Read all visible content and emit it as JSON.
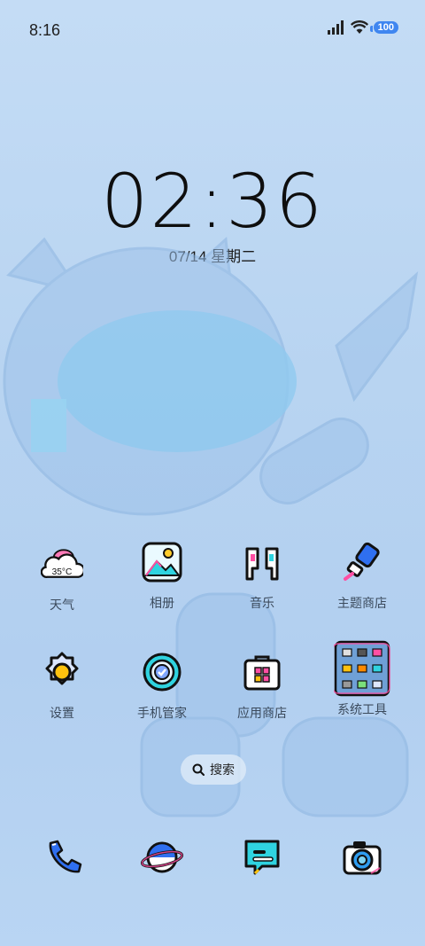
{
  "status": {
    "time": "8:16",
    "battery": "100",
    "signal_icon": "signal-icon",
    "wifi_icon": "wifi-icon"
  },
  "lock": {
    "clock": "02:36",
    "date": "07/14 星期二"
  },
  "apps_row1": [
    {
      "label": "天气",
      "icon": "weather-icon",
      "icon_text": "35°C"
    },
    {
      "label": "相册",
      "icon": "gallery-icon"
    },
    {
      "label": "音乐",
      "icon": "music-icon"
    },
    {
      "label": "主题商店",
      "icon": "theme-store-icon"
    }
  ],
  "apps_row2": [
    {
      "label": "设置",
      "icon": "settings-icon"
    },
    {
      "label": "手机管家",
      "icon": "phone-manager-icon"
    },
    {
      "label": "应用商店",
      "icon": "app-store-icon"
    },
    {
      "label": "系统工具",
      "icon": "system-tools-folder-icon"
    }
  ],
  "search": {
    "label": "搜索",
    "icon": "search-icon"
  },
  "dock": [
    {
      "name": "phone",
      "icon": "phone-icon"
    },
    {
      "name": "browser",
      "icon": "browser-icon"
    },
    {
      "name": "messages",
      "icon": "messages-icon"
    },
    {
      "name": "camera",
      "icon": "camera-icon"
    }
  ],
  "colors": {
    "accent": "#3f86f0",
    "background": "#b8d4f1",
    "outline": "#111111",
    "pink": "#ff4fa3",
    "cyan": "#2fd3e0"
  }
}
